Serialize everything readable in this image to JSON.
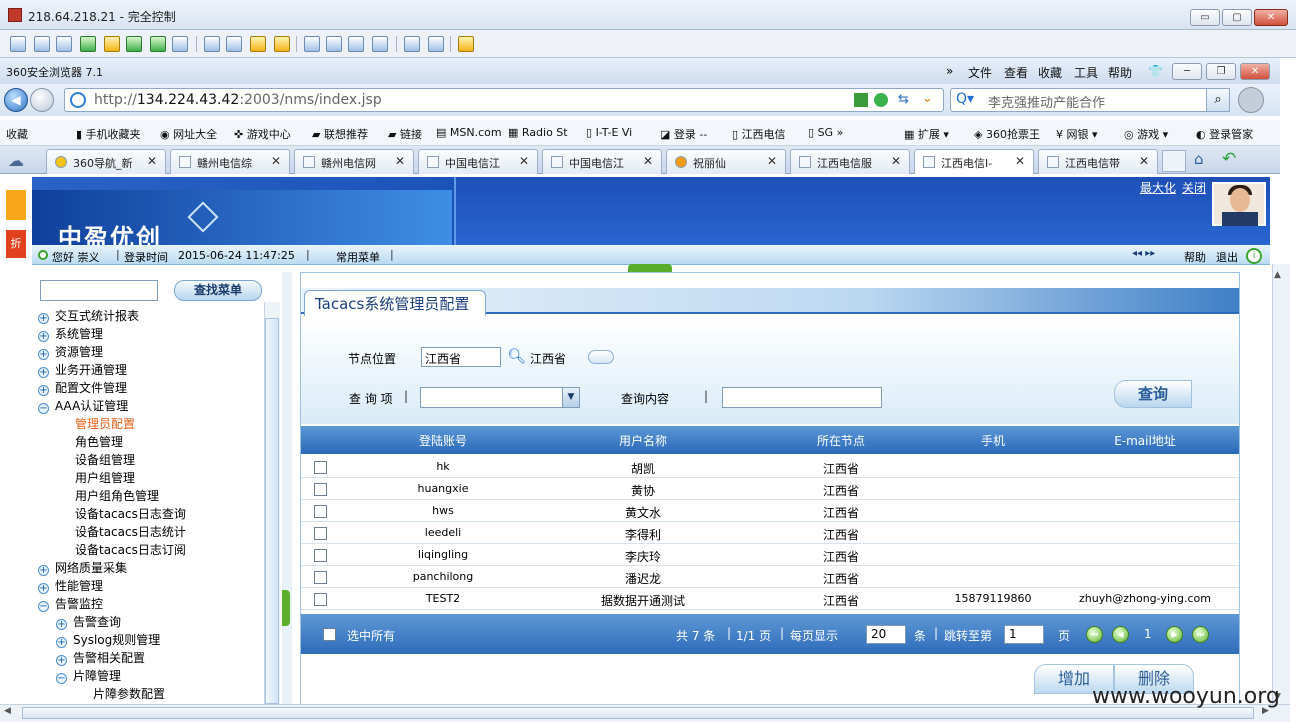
{
  "remote_window": {
    "title": "218.64.218.21 - 完全控制",
    "min": "▭",
    "max": "▢",
    "close": "✕"
  },
  "browser": {
    "name": "360安全浏览器 7.1",
    "menu": [
      "文件",
      "查看",
      "收藏",
      "工具",
      "帮助"
    ],
    "url_prefix": "http://",
    "url_host": "134.224.43.42",
    "url_rest": ":2003/nms/index.jsp",
    "search_text": "李克强推动产能合作",
    "favorites": [
      "收藏",
      "手机收藏夹",
      "网址大全",
      "游戏中心",
      "联想推荐",
      "链接",
      "MSN.com",
      "Radio St",
      "I-T-E Vi",
      "登录 --",
      "江西电信",
      "SG",
      "扩展",
      "360抢票王",
      "网银",
      "游戏",
      "登录管家"
    ],
    "tabs": [
      "360导航_新",
      "赣州电信综",
      "赣州电信网",
      "中国电信江",
      "中国电信江",
      "祝丽仙",
      "江西电信服",
      "江西电信I-",
      "江西电信带"
    ]
  },
  "header": {
    "logo": "中盈优创",
    "maximize": "最大化",
    "close": "关闭"
  },
  "status": {
    "greeting": "您好 崇义",
    "login_time_label": "登录时间",
    "login_time": "2015-06-24 11:47:25",
    "common_menu": "常用菜单",
    "help": "帮助",
    "exit": "退出"
  },
  "side": {
    "red_tab": "折"
  },
  "tree": {
    "search_button": "查找菜单",
    "nodes": [
      {
        "label": "交互式统计报表",
        "sign": "+"
      },
      {
        "label": "系统管理",
        "sign": "+"
      },
      {
        "label": "资源管理",
        "sign": "+"
      },
      {
        "label": "业务开通管理",
        "sign": "+"
      },
      {
        "label": "配置文件管理",
        "sign": "+"
      },
      {
        "label": "AAA认证管理",
        "sign": "−"
      }
    ],
    "aaa_children": [
      "管理员配置",
      "角色管理",
      "设备组管理",
      "用户组管理",
      "用户组角色管理",
      "设备tacacs日志查询",
      "设备tacacs日志统计",
      "设备tacacs日志订阅"
    ],
    "nodes2": [
      {
        "label": "网络质量采集",
        "sign": "+"
      },
      {
        "label": "性能管理",
        "sign": "+"
      },
      {
        "label": "告警监控",
        "sign": "−"
      }
    ],
    "alarm_children": [
      {
        "label": "告警查询",
        "sign": "+"
      },
      {
        "label": "Syslog规则管理",
        "sign": "+"
      },
      {
        "label": "告警相关配置",
        "sign": "+"
      },
      {
        "label": "片障管理",
        "sign": "−"
      }
    ],
    "fault_children": [
      "片障参数配置"
    ]
  },
  "panel": {
    "title": "Tacacs系统管理员配置",
    "node_label": "节点位置",
    "node_value": "江西省",
    "node_text": "江西省",
    "query_item_label": "查 询 项",
    "query_content_label": "查询内容",
    "query_button": "查询"
  },
  "grid": {
    "columns": [
      "登陆账号",
      "用户名称",
      "所在节点",
      "手机",
      "E-mail地址"
    ],
    "rows": [
      {
        "account": "hk",
        "name": "胡凯",
        "node": "江西省",
        "phone": "",
        "email": ""
      },
      {
        "account": "huangxie",
        "name": "黄协",
        "node": "江西省",
        "phone": "",
        "email": ""
      },
      {
        "account": "hws",
        "name": "黄文水",
        "node": "江西省",
        "phone": "",
        "email": ""
      },
      {
        "account": "leedeli",
        "name": "李得利",
        "node": "江西省",
        "phone": "",
        "email": ""
      },
      {
        "account": "liqingling",
        "name": "李庆玲",
        "node": "江西省",
        "phone": "",
        "email": ""
      },
      {
        "account": "panchilong",
        "name": "潘迟龙",
        "node": "江西省",
        "phone": "",
        "email": ""
      },
      {
        "account": "TEST2",
        "name": "据数据开通测试",
        "node": "江西省",
        "phone": "15879119860",
        "email": "zhuyh@zhong-ying.com"
      }
    ]
  },
  "footer": {
    "select_all": "选中所有",
    "total": "共 7 条",
    "pages": "1/1 页",
    "per_page_label": "每页显示",
    "per_page": "20",
    "unit": "条",
    "jump_label": "跳转至第",
    "jump_page": "1",
    "page_unit": "页",
    "current": "1"
  },
  "actions": {
    "add": "增加",
    "delete": "删除"
  },
  "watermark": "www.wooyun.org"
}
